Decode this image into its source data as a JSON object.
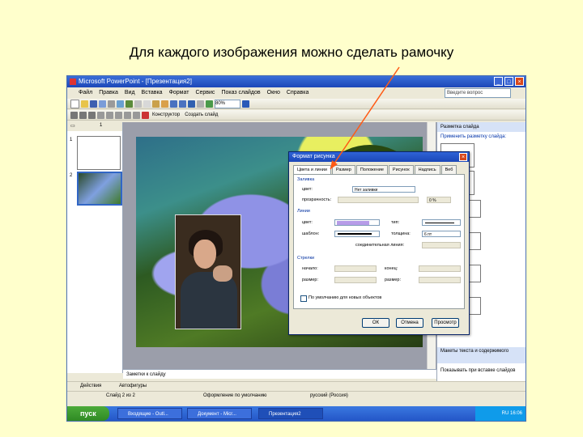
{
  "slide_title": "Для каждого изображения можно сделать рамочку",
  "window": {
    "title": "Microsoft PowerPoint - [Презентация2]"
  },
  "help_box": "Введите вопрос",
  "menu": [
    "Файл",
    "Правка",
    "Вид",
    "Вставка",
    "Формат",
    "Сервис",
    "Показ слайдов",
    "Окно",
    "Справка"
  ],
  "toolbar": {
    "zoom": "80%",
    "designer": "Конструктор",
    "new_slide": "Создать слайд"
  },
  "thumbs": {
    "n1": "1",
    "n2": "2"
  },
  "notes": "Заметки к слайду",
  "task_pane": {
    "title": "Разметка слайда",
    "link": "Применить разметку слайда:",
    "footer": "Макеты текста и содержимого",
    "show_on_insert": "Показывать при вставке слайдов"
  },
  "status": {
    "slide": "Слайд 2 из 2",
    "design": "Оформление по умолчанию",
    "lang": "русский (Россия)"
  },
  "draw": {
    "actions": "Действия",
    "autoshapes": "Автофигуры"
  },
  "taskbar": {
    "start": "пуск",
    "tasks": [
      "Входящие - Outl...",
      "Документ - Micr...",
      "Презентация2"
    ],
    "tray_lang": "RU",
    "time": "16:06"
  },
  "dialog": {
    "title": "Формат рисунка",
    "tabs": [
      "Цвета и линии",
      "Размер",
      "Положение",
      "Рисунок",
      "Надпись",
      "Веб"
    ],
    "fill_group": "Заливка",
    "fill_color_label": "цвет:",
    "fill_color_value": "Нет заливки",
    "transparency_label": "прозрачность:",
    "transparency_value": "0 %",
    "line_group": "Линии",
    "line_color_label": "цвет:",
    "line_type_label": "шаблон:",
    "line_dash_label": "тип:",
    "line_weight_label": "толщина:",
    "line_weight_value": "6 пт",
    "connector_label": "соединительная линия:",
    "arrows_group": "Стрелки",
    "begin_style": "начало:",
    "end_style": "конец:",
    "begin_size": "размер:",
    "end_size": "размер:",
    "default_checkbox": "По умолчанию для новых объектов",
    "ok": "ОК",
    "cancel": "Отмена",
    "preview": "Просмотр"
  },
  "colors": {
    "line_color_swatch": "#b79ce8",
    "start_green": "#3b9a2f",
    "title_blue": "#2158c8"
  }
}
